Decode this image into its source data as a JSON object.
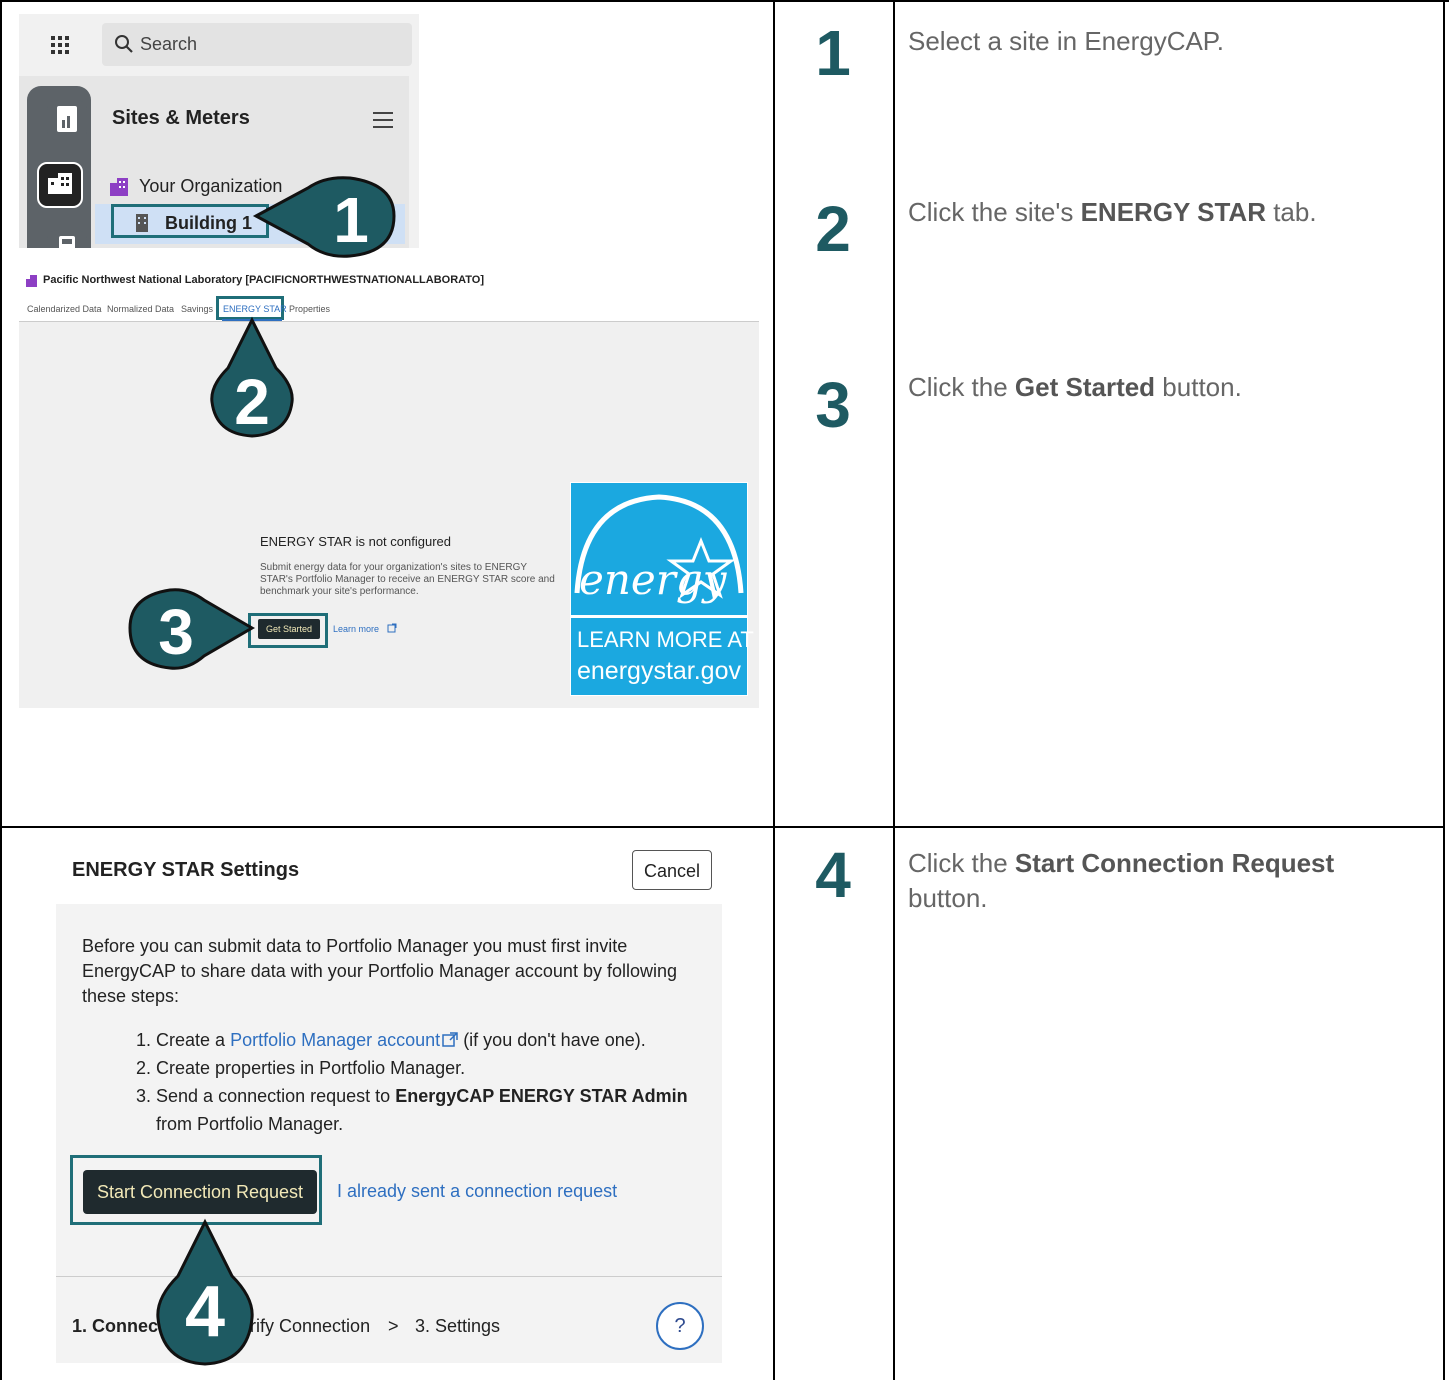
{
  "panel_a": {
    "search_placeholder": "Search",
    "section_title": "Sites & Meters",
    "tree_org": "Your Organization",
    "tree_site": "Building 1"
  },
  "panel_b": {
    "site_title": "Pacific Northwest National Laboratory [PACIFICNORTHWESTNATIONALLABORATO]",
    "tabs": [
      "Calendarized Data",
      "Normalized Data",
      "Savings",
      "ENERGY STAR",
      "Properties"
    ],
    "heading": "ENERGY STAR is not configured",
    "description": "Submit energy data for your organization's sites to ENERGY STAR's Portfolio Manager to receive an ENERGY STAR score and benchmark your site's performance.",
    "get_started": "Get Started",
    "learn_more": "Learn more",
    "logo_script": "energy",
    "logo_line1": "LEARN MORE AT",
    "logo_line2": "energystar.gov"
  },
  "panel_c": {
    "title": "ENERGY STAR Settings",
    "cancel": "Cancel",
    "intro": "Before you can submit data to Portfolio Manager you must first invite EnergyCAP to share data with your Portfolio Manager account by following these steps:",
    "item1_prefix": "1. Create a ",
    "item1_link": "Portfolio Manager account",
    "item1_suffix": " (if you don't have one).",
    "item2": "2. Create properties in Portfolio Manager.",
    "item3_prefix": "3. Send a connection request to ",
    "item3_bold": "EnergyCAP ENERGY STAR Admin",
    "item3_suffix": "from Portfolio Manager.",
    "start_button": "Start Connection Request",
    "already_sent": "I already sent a connection request",
    "wizard_step1": "1. Connect",
    "wizard_step2": "Verify Connection",
    "wizard_sep": ">",
    "wizard_step3": "3. Settings",
    "help": "?"
  },
  "callouts": [
    "1",
    "2",
    "3",
    "4"
  ],
  "steps": {
    "n1": "1",
    "s1_text": "Select a site in EnergyCAP.",
    "n2": "2",
    "s2_pre": "Click the site's ",
    "s2_bold": "ENERGY STAR",
    "s2_post": " tab.",
    "n3": "3",
    "s3_pre": "Click the ",
    "s3_bold": "Get Started",
    "s3_post": " button.",
    "n4": "4",
    "s4_pre": "Click the ",
    "s4_bold": "Start Connection Request",
    "s4_post": "button."
  },
  "colors": {
    "teal": "#1e5a62",
    "highlight": "#1f6e78",
    "link": "#2e6fc0",
    "energy_blue": "#1ba8e0"
  }
}
